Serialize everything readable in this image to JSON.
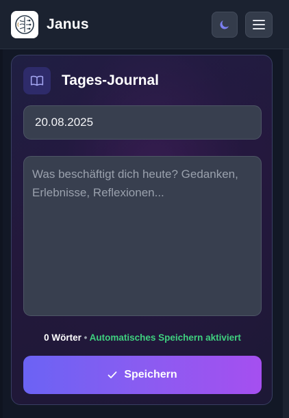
{
  "header": {
    "app_name": "Janus",
    "icons": {
      "logo": "brain-circuit-logo",
      "theme": "moon-icon",
      "menu": "hamburger-menu-icon"
    }
  },
  "journal": {
    "title": "Tages-Journal",
    "title_icon": "open-book-icon",
    "date_value": "20.08.2025",
    "text_value": "",
    "text_placeholder": "Was beschäftigt dich heute? Gedanken, Erlebnisse, Reflexionen...",
    "word_count": "0 Wörter",
    "separator": "•",
    "autosave_status": "Automatisches Speichern aktiviert",
    "save_label": "Speichern",
    "save_icon": "check-icon"
  },
  "colors": {
    "accent_start": "#6b63f4",
    "accent_end": "#a54ff0",
    "autosave_green": "#3fd07f",
    "moon": "#7b7ff0"
  }
}
